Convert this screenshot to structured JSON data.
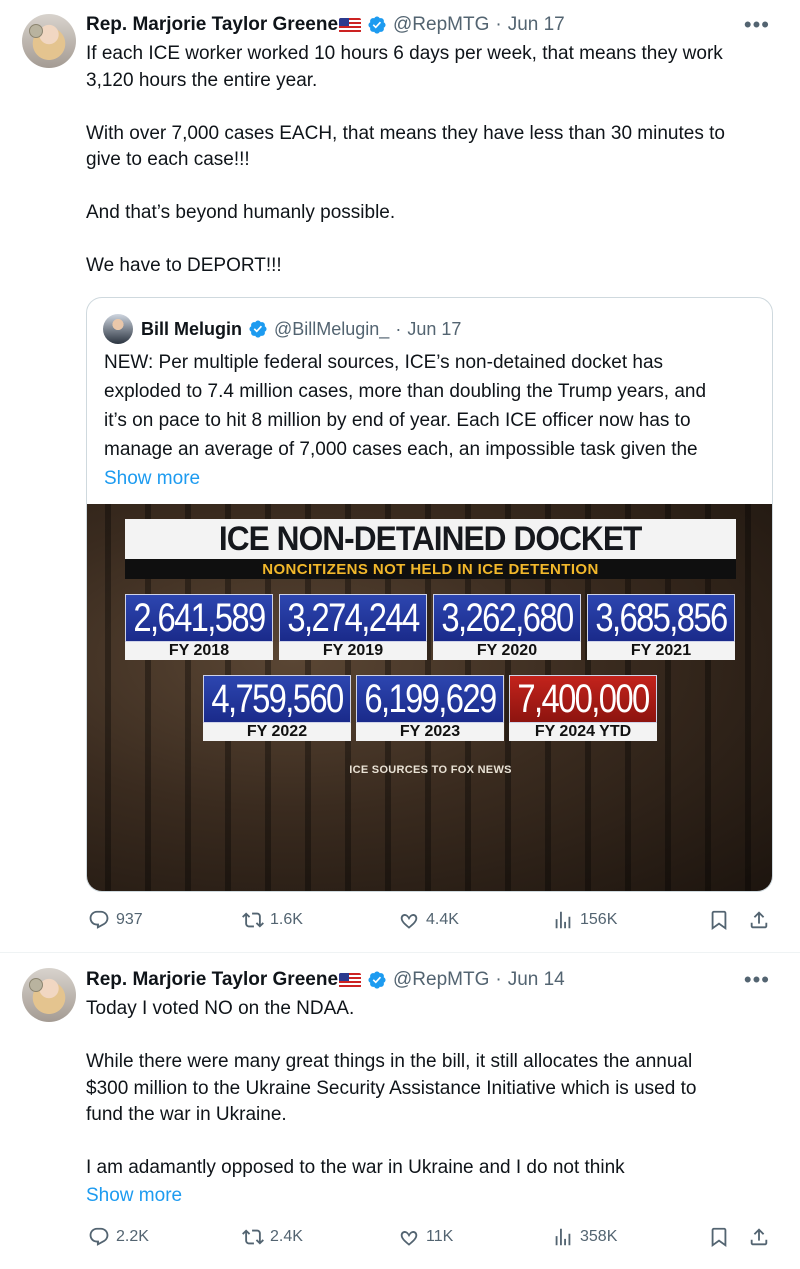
{
  "tweet1": {
    "author_name": "Rep. Marjorie Taylor Greene",
    "handle": "@RepMTG",
    "separator": "·",
    "date": "Jun 17",
    "more": "•••",
    "lines": [
      "If each ICE worker worked 10 hours 6 days per week, that means they work",
      "3,120 hours the entire year.",
      "",
      "With over 7,000 cases EACH, that means they have less than 30 minutes to",
      "give to each case!!!",
      "",
      "And that’s beyond humanly possible.",
      "",
      "We have to DEPORT!!!"
    ],
    "quote": {
      "author_name": "Bill Melugin",
      "handle": "@BillMelugin_",
      "separator": "·",
      "date": "Jun 17",
      "lines": [
        "NEW: Per multiple federal sources, ICE’s non-detained docket has",
        "exploded to 7.4 million cases, more than doubling the Trump years, and",
        "it’s on pace to hit 8 million by end of year. Each ICE officer now has to",
        "manage an average of 7,000 cases each, an impossible task given the"
      ],
      "show_more": "Show more",
      "graphic": {
        "title": "ICE NON-DETAINED DOCKET",
        "subtitle": "NONCITIZENS NOT HELD IN ICE DETENTION",
        "stats": [
          {
            "value": "2,641,589",
            "label": "FY 2018"
          },
          {
            "value": "3,274,244",
            "label": "FY 2019"
          },
          {
            "value": "3,262,680",
            "label": "FY 2020"
          },
          {
            "value": "3,685,856",
            "label": "FY 2021"
          },
          {
            "value": "4,759,560",
            "label": "FY 2022"
          },
          {
            "value": "6,199,629",
            "label": "FY 2023"
          },
          {
            "value": "7,400,000",
            "label": "FY 2024 YTD"
          }
        ],
        "source": "ICE SOURCES TO FOX NEWS"
      }
    },
    "stats": {
      "replies": "937",
      "reposts": "1.6K",
      "likes": "4.4K",
      "views": "156K"
    }
  },
  "tweet2": {
    "author_name": "Rep. Marjorie Taylor Greene",
    "handle": "@RepMTG",
    "separator": "·",
    "date": "Jun 14",
    "more": "•••",
    "lines": [
      "Today I voted NO on the NDAA.",
      "",
      "While there were many great things in the bill, it still allocates the annual",
      "$300 million to the Ukraine Security Assistance Initiative which is used to",
      "fund the war in Ukraine.",
      "",
      "I am adamantly opposed to the war in Ukraine and I do not think"
    ],
    "show_more": "Show more",
    "stats": {
      "replies": "2.2K",
      "reposts": "2.4K",
      "likes": "11K",
      "views": "358K"
    }
  },
  "colors": {
    "accent": "#1d9bf0",
    "muted": "#536471",
    "text": "#0f1419",
    "verified": "#1d9bf0"
  },
  "icons": [
    "reply-icon",
    "repost-icon",
    "like-icon",
    "views-icon",
    "bookmark-icon",
    "share-icon",
    "verified-icon",
    "flag-icon"
  ]
}
